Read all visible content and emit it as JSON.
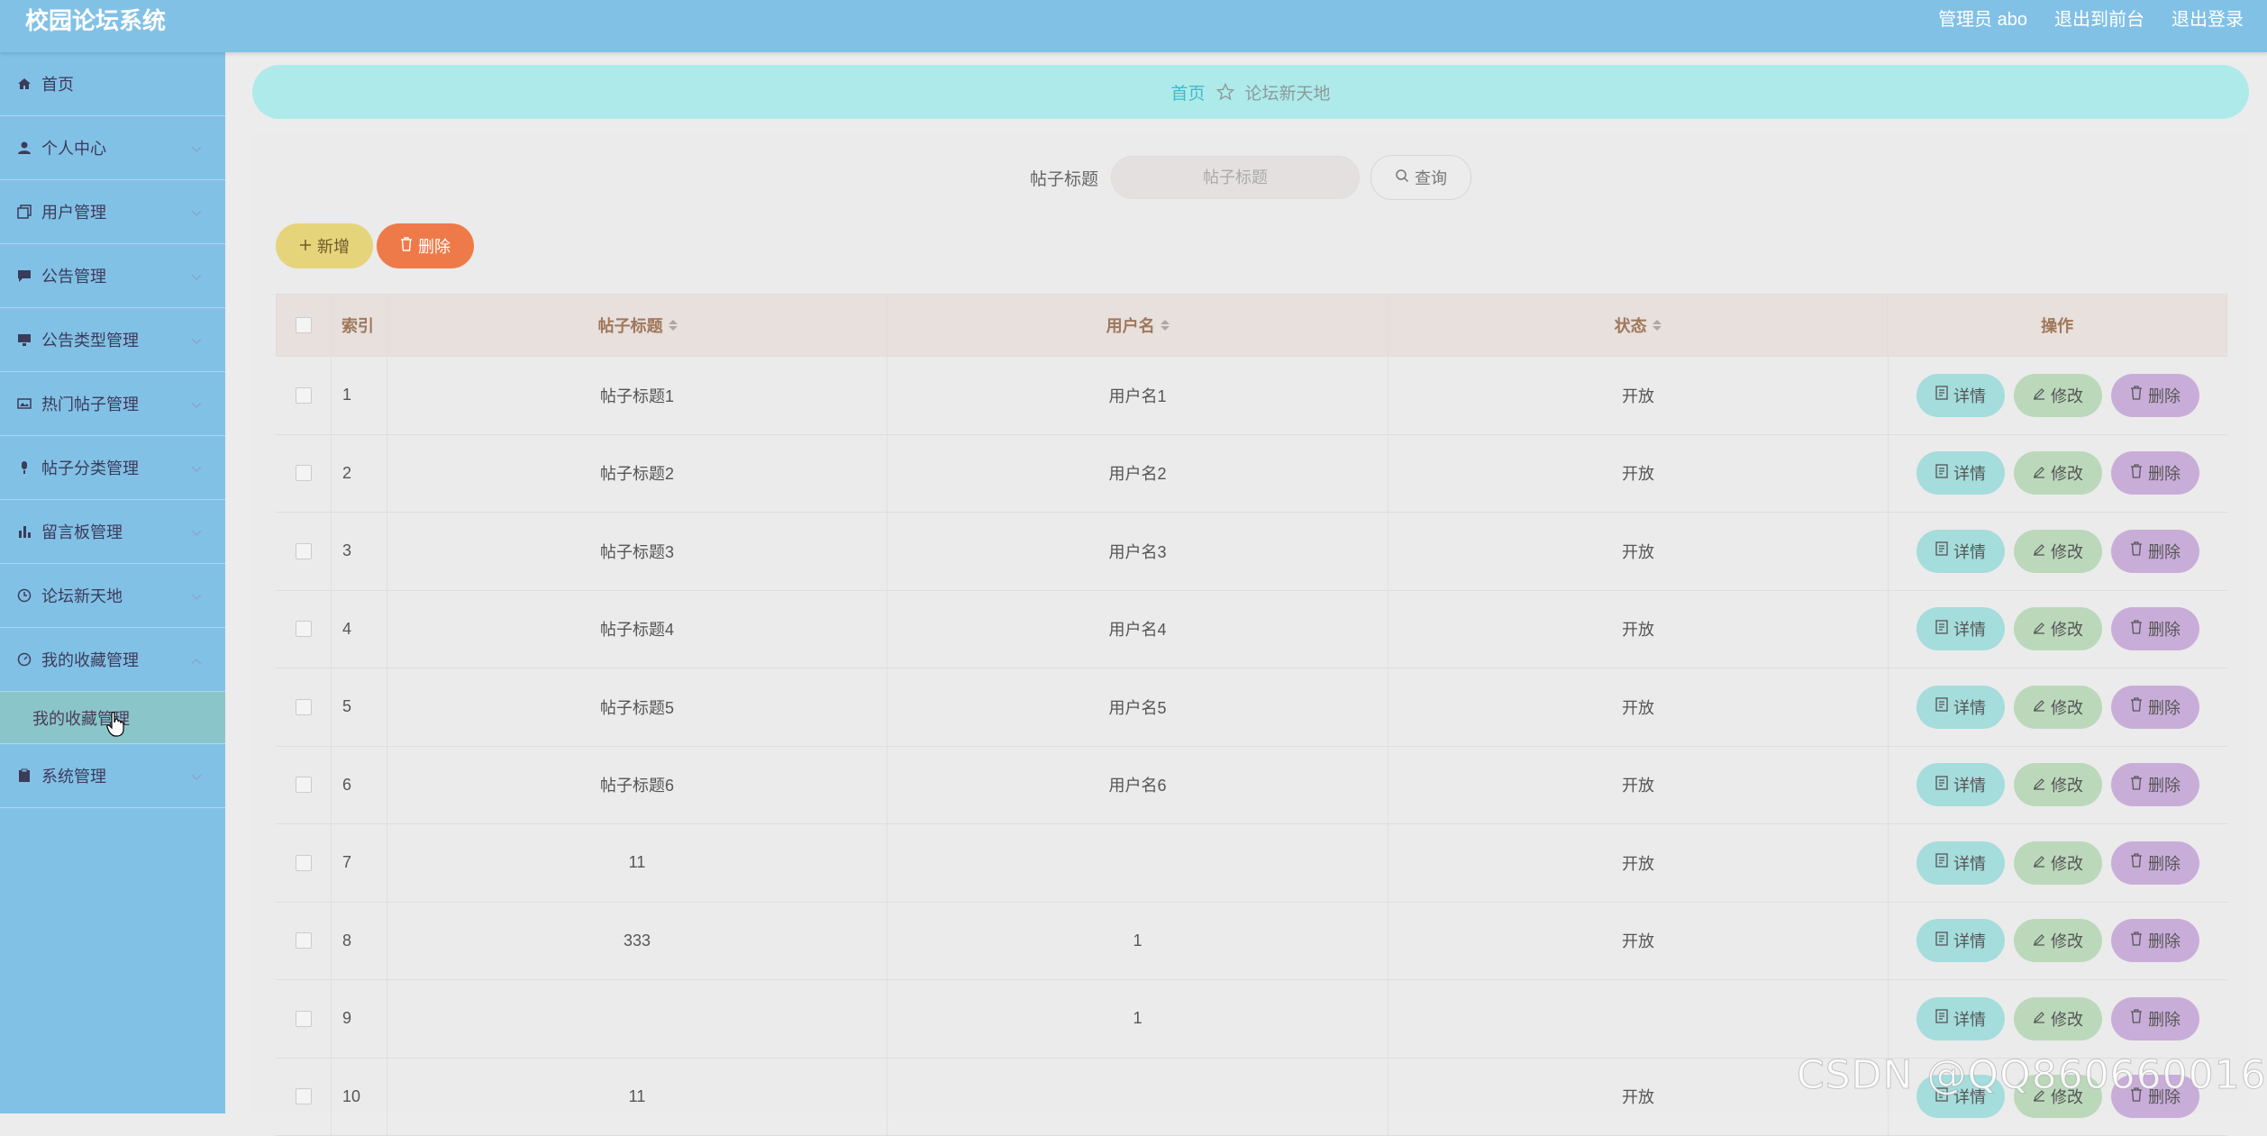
{
  "app": {
    "title": "校园论坛系统",
    "admin_label": "管理员 abo",
    "front_link": "退出到前台",
    "logout_link": "退出登录"
  },
  "sidebar": {
    "items": [
      {
        "label": "首页",
        "icon": "home-icon",
        "chevron": false
      },
      {
        "label": "个人中心",
        "icon": "user-icon",
        "chevron": true
      },
      {
        "label": "用户管理",
        "icon": "copy-icon",
        "chevron": true
      },
      {
        "label": "公告管理",
        "icon": "chat-icon",
        "chevron": true
      },
      {
        "label": "公告类型管理",
        "icon": "monitor-icon",
        "chevron": true
      },
      {
        "label": "热门帖子管理",
        "icon": "picture-icon",
        "chevron": true
      },
      {
        "label": "帖子分类管理",
        "icon": "mic-icon",
        "chevron": true
      },
      {
        "label": "留言板管理",
        "icon": "bar-chart-icon",
        "chevron": true
      },
      {
        "label": "论坛新天地",
        "icon": "clock-icon",
        "chevron": true
      },
      {
        "label": "我的收藏管理",
        "icon": "gauge-icon",
        "chevron": "up"
      },
      {
        "label": "系统管理",
        "icon": "clipboard-icon",
        "chevron": true
      }
    ],
    "submenu_label": "我的收藏管理"
  },
  "breadcrumb": {
    "home": "首页",
    "current": "论坛新天地"
  },
  "search": {
    "label": "帖子标题",
    "placeholder": "帖子标题",
    "button": "查询"
  },
  "actions": {
    "add": "新增",
    "delete": "删除"
  },
  "table": {
    "headers": {
      "index": "索引",
      "title": "帖子标题",
      "username": "用户名",
      "status": "状态",
      "ops": "操作"
    },
    "rows": [
      {
        "index": "1",
        "title": "帖子标题1",
        "username": "用户名1",
        "status": "开放"
      },
      {
        "index": "2",
        "title": "帖子标题2",
        "username": "用户名2",
        "status": "开放"
      },
      {
        "index": "3",
        "title": "帖子标题3",
        "username": "用户名3",
        "status": "开放"
      },
      {
        "index": "4",
        "title": "帖子标题4",
        "username": "用户名4",
        "status": "开放"
      },
      {
        "index": "5",
        "title": "帖子标题5",
        "username": "用户名5",
        "status": "开放"
      },
      {
        "index": "6",
        "title": "帖子标题6",
        "username": "用户名6",
        "status": "开放"
      },
      {
        "index": "7",
        "title": "11",
        "username": "",
        "status": "开放"
      },
      {
        "index": "8",
        "title": "333",
        "username": "1",
        "status": "开放"
      },
      {
        "index": "9",
        "title": "",
        "username": "1",
        "status": ""
      },
      {
        "index": "10",
        "title": "11",
        "username": "",
        "status": "开放"
      }
    ],
    "op_labels": {
      "detail": "详情",
      "edit": "修改",
      "delete": "删除"
    }
  },
  "watermark": "CSDN @QQ860660016",
  "colors": {
    "header_bg": "#82c1e6",
    "breadcrumb_bg": "#afeaea",
    "add_btn": "#e6d47a",
    "delete_btn": "#ef7a49",
    "detail_btn": "#a5dcdc",
    "edit_btn": "#bbd8bb",
    "row_delete_btn": "#c9add9"
  }
}
